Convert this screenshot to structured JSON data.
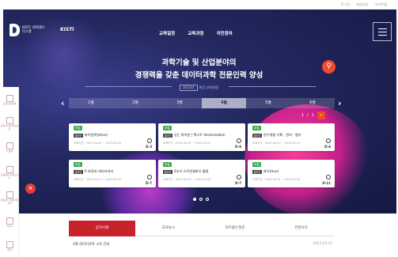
{
  "top_links": [
    "로그인",
    "회원가입",
    "사이트맵"
  ],
  "header": {
    "logo_text": "KISTI 과학데이터스쿨",
    "partner_logo": "KISTI",
    "nav": [
      "교육일정",
      "교육과정",
      "국민참여"
    ],
    "menu_icon": "hamburger-icon"
  },
  "hero": {
    "headline_line1": "과학기술 및 산업분야의",
    "headline_line2": "경쟁력을 갖춘 데이터과학 전문인력 양성",
    "year_badge": "2023년",
    "subline": "연간 교육일정",
    "search_icon": "search-icon"
  },
  "weeks": {
    "items": [
      "1월",
      "2월",
      "3월",
      "4월",
      "5월",
      "6월"
    ],
    "active_index": 3,
    "prev_icon": "chevron-left-icon",
    "next_icon": "chevron-right-icon"
  },
  "pager": {
    "current": "1",
    "sep": "/",
    "total": "1",
    "next_label": "›"
  },
  "cards": [
    {
      "tag": "모집",
      "sub": "온라인",
      "title": "파이썬(Python)",
      "date": "교육기간 : 2023-04-03 ~ 2023-04-05",
      "num": "D-3"
    },
    {
      "tag": "모집",
      "sub": "온라인",
      "title": "공는 파이썬 | 텍스트 Vectorization",
      "date": "교육기간 : 2023-04-10 ~ 2023-04-12",
      "num": "D-6"
    },
    {
      "tag": "모집",
      "sub": "온라인",
      "title": "연구개발 기획 · 관리 · 평가",
      "date": "교육기간 : 2023-04-10 ~ 2023-04-14",
      "num": "D-6"
    },
    {
      "tag": "모집",
      "sub": "온라인",
      "title": "R 자료머 데이터처리",
      "date": "교육기간 : 2023-04-17 ~ 2023-04-19",
      "num": "D-7"
    },
    {
      "tag": "모집",
      "sub": "온라인",
      "title": "5조기 소득연결파이 활용",
      "date": "교육기간 : 2023-04-24 ~ 2023-04-26",
      "num": "D-7"
    },
    {
      "tag": "모집",
      "sub": "온라인",
      "title": "파이(Hue)",
      "date": "교육기간 : 2023-04-24 ~ 2023-04-28",
      "num": "D-11"
    }
  ],
  "side_items": [
    "교육신청현황",
    "교육이수증 발급신청",
    "수료증",
    "교육종합 만족도조사",
    "경험관리 경험과정조회",
    "Q&A",
    "공지"
  ],
  "tabs": [
    "공지사항",
    "교육뉴스",
    "자주묻는질문",
    "언론보도"
  ],
  "news": {
    "title": "4월 데이터과학 교육 안내",
    "date": "2023.03.22"
  },
  "colors": {
    "accent_red": "#c8222d",
    "search_orange": "#f04a2c",
    "tag_green": "#3cab4e",
    "hero_bg": "#23285f"
  }
}
